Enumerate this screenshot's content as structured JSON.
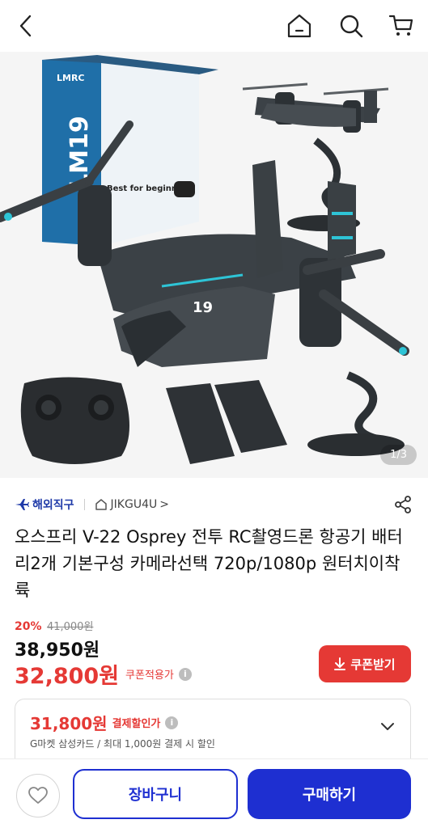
{
  "header": {
    "back_icon": "chevron-left-icon",
    "home_icon": "home-icon",
    "search_icon": "search-icon",
    "cart_icon": "cart-icon"
  },
  "gallery": {
    "page_indicator": "1/3",
    "box_label": "LM19",
    "box_brand": "LMRC",
    "box_tagline": "Best for beginners"
  },
  "seller": {
    "overseas_label": "해외직구",
    "store_name": "JIKGU4U",
    "store_chevron": ">"
  },
  "product": {
    "title": "오스프리 V-22 Osprey 전투 RC촬영드론 항공기 배터리2개 기본구성 카메라선택 720p/1080p 원터치이착륙"
  },
  "pricing": {
    "discount_rate": "20%",
    "original_price": "41,000원",
    "sale_price": "38,950원",
    "coupon_price": "32,800원",
    "coupon_label": "쿠폰적용가",
    "coupon_button": "쿠폰받기",
    "accent_color": "#e53935"
  },
  "card_offer": {
    "price": "31,800원",
    "label": "결제할인가",
    "description": "G마켓 삼성카드 / 최대 1,000원 결제 시 할인"
  },
  "footer": {
    "wishlist_icon": "heart-icon",
    "cart_button": "장바구니",
    "buy_button": "구매하기",
    "brand_color": "#1e2fd1"
  }
}
